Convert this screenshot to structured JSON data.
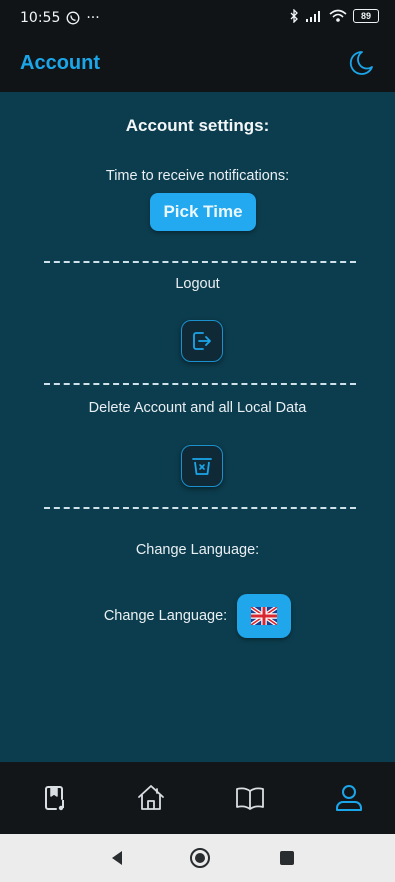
{
  "status_bar": {
    "time": "10:55",
    "battery": "89"
  },
  "app_bar": {
    "title": "Account"
  },
  "content": {
    "settings_title": "Account settings:",
    "notifications_label": "Time to receive notifications:",
    "pick_time_label": "Pick Time",
    "logout_label": "Logout",
    "delete_label": "Delete Account and all Local Data",
    "change_language_heading": "Change Language:",
    "change_language_label": "Change Language:"
  },
  "colors": {
    "accent": "#1ba6ea",
    "background": "#0c3d4e",
    "bar": "#111417"
  },
  "bottom_nav": {
    "items": [
      {
        "icon": "bookmark-music-icon",
        "active": false
      },
      {
        "icon": "home-icon",
        "active": false
      },
      {
        "icon": "book-icon",
        "active": false
      },
      {
        "icon": "user-icon",
        "active": true
      }
    ]
  }
}
